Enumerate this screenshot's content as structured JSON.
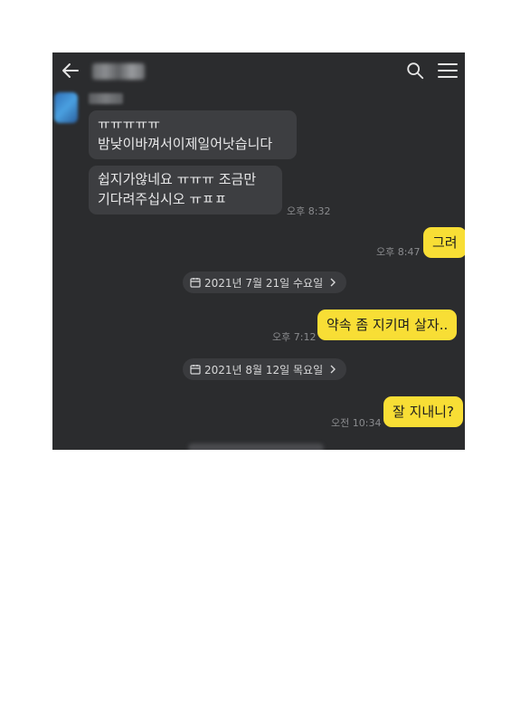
{
  "messages": [
    {
      "type": "received",
      "text": "ㅠㅠㅠㅠㅠ\n밤낮이바껴서이제일어낫습니다"
    },
    {
      "type": "received",
      "text": "쉽지가않네요 ㅠㅠㅠ 조금만\n기다려주십시오 ㅠㅍㅍ",
      "time": "오후 8:32"
    },
    {
      "type": "sent",
      "text": "그려",
      "time": "오후 8:47"
    },
    {
      "type": "date",
      "text": "2021년 7월 21일 수요일"
    },
    {
      "type": "sent",
      "text": "약속 좀 지키며 살자..",
      "time": "오후 7:12"
    },
    {
      "type": "date",
      "text": "2021년 8월 12일 목요일"
    },
    {
      "type": "sent",
      "text": "잘 지내니?",
      "time": "오전 10:34"
    }
  ],
  "icons": {
    "back": "back-arrow-icon",
    "search": "search-icon",
    "menu": "hamburger-menu-icon",
    "calendar": "calendar-icon",
    "chevron": "chevron-right-icon"
  },
  "colors": {
    "background": "#2b2c2e",
    "received_bubble": "#3d3e41",
    "sent_bubble": "#f8de35",
    "time_text": "#8a8b8e"
  }
}
